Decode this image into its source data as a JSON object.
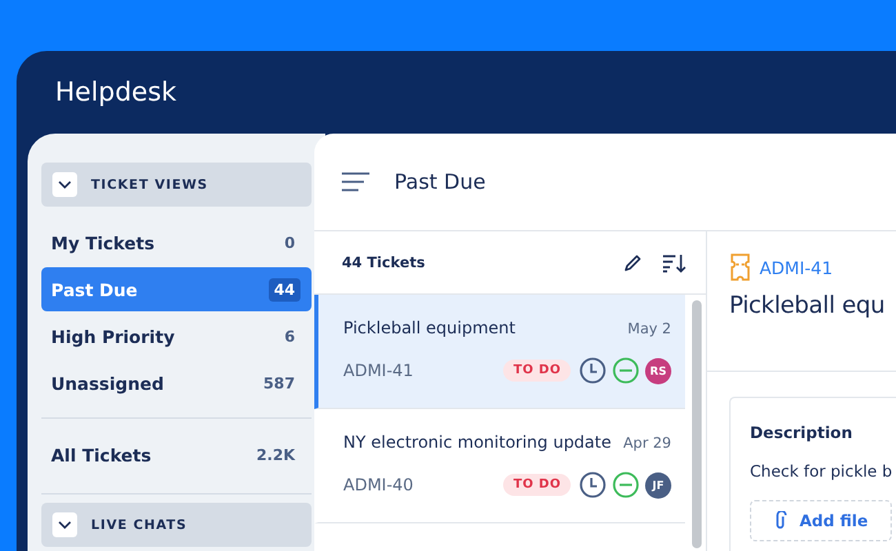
{
  "window": {
    "title": "Helpdesk"
  },
  "sidebar": {
    "sections": [
      {
        "title": "TICKET VIEWS",
        "items": [
          {
            "label": "My Tickets",
            "count": "0",
            "selected": false
          },
          {
            "label": "Past Due",
            "count": "44",
            "selected": true
          },
          {
            "label": "High Priority",
            "count": "6",
            "selected": false
          },
          {
            "label": "Unassigned",
            "count": "587",
            "selected": false
          }
        ]
      },
      {
        "items": [
          {
            "label": "All Tickets",
            "count": "2.2K",
            "selected": false
          }
        ]
      },
      {
        "title": "LIVE CHATS"
      }
    ]
  },
  "header": {
    "title": "Past Due"
  },
  "list": {
    "count": "44 Tickets",
    "tickets": [
      {
        "title": "Pickleball equipment",
        "date": "May 2",
        "id": "ADMI-41",
        "status": "TO DO",
        "assignee": "RS",
        "color": "#c73d7f",
        "selected": true
      },
      {
        "title": "NY electronic monitoring update",
        "date": "Apr 29",
        "id": "ADMI-40",
        "status": "TO DO",
        "assignee": "JF",
        "color": "#4a5f85",
        "selected": false
      }
    ]
  },
  "detail": {
    "id": "ADMI-41",
    "title": "Pickleball equ",
    "description_label": "Description",
    "description": "Check for pickle b",
    "add_file": "Add file"
  }
}
